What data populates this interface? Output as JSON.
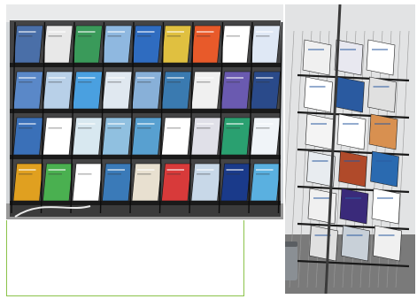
{
  "colors": {
    "wall": "#cfd2d5",
    "rack": "#1a1a1a",
    "caption_border": "#8bc34a",
    "floor": "#6b6b6b"
  },
  "left_rack": {
    "row_count": 4,
    "slot_count": 9,
    "brochures": [
      [
        "#4a6fa8",
        "#e8e8e8",
        "#3a9a5a",
        "#8fb8e0",
        "#2f6cc0",
        "#e0c040",
        "#e85a2a",
        "#ffffff",
        "#dfe8f5"
      ],
      [
        "#5a88c8",
        "#b8d0e8",
        "#4aa0e0",
        "#e0e8f0",
        "#88b0d8",
        "#3a7ab0",
        "#f0f0f0",
        "#6a5ab0",
        "#2a4a8a"
      ],
      [
        "#3a70b8",
        "#ffffff",
        "#d8e8f0",
        "#90c0e0",
        "#58a0d0",
        "#ffffff",
        "#e0e0e8",
        "#2aa070",
        "#f0f4f8"
      ],
      [
        "#e0a020",
        "#4ab050",
        "#ffffff",
        "#3a7ab8",
        "#e8e0d0",
        "#d83a3a",
        "#c8d8e8",
        "#1a3a8a",
        "#5ab0e0"
      ]
    ]
  },
  "right_rack": {
    "row_count": 6,
    "brochures": [
      [
        "#f0f0f0",
        "#e8e8f0",
        "#ffffff"
      ],
      [
        "#ffffff",
        "#2a5aa0",
        "#e0e0e0"
      ],
      [
        "#f4f4f4",
        "#ffffff",
        "#d89050"
      ],
      [
        "#e8ecf0",
        "#b04a2a",
        "#2a6ab0"
      ],
      [
        "#f0f0f0",
        "#3a2a7a",
        "#ffffff"
      ],
      [
        "#e0e0e0",
        "#c8d0d8",
        "#f0f0f0"
      ]
    ]
  }
}
